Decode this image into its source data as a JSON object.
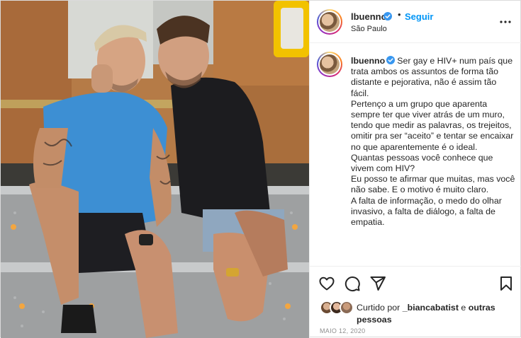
{
  "post": {
    "image_alt": "Two men sitting together on a metal step platform in front of an orange truck",
    "header": {
      "username": "lbuenno",
      "separator": "•",
      "follow_label": "Seguir",
      "location": "São Paulo"
    },
    "caption": {
      "username": "lbuenno",
      "lines": [
        "Ser gay e HIV+ num país que trata ambos os assuntos de forma tão distante e pejorativa, não é assim tão fácil.",
        "Pertenço a um grupo que aparenta sempre ter que viver atrás de um muro, tendo que medir as palavras, os trejeitos, omitir pra ser “aceito” e tentar se encaixar no que aparentemente é o ideal.",
        "Quantas pessoas você conhece que vivem com HIV?",
        "Eu posso te afirmar que muitas, mas você não sabe. E o motivo é muito claro.",
        "A falta de informação, o medo do olhar invasivo, a falta de diálogo, a falta de empatia."
      ]
    },
    "likes": {
      "prefix": "Curtido por",
      "user": "_biancabatist",
      "connector": "e",
      "others": "outras pessoas"
    },
    "date": "MAIO 12, 2020",
    "icons": {
      "verified": "verified-badge-icon",
      "more": "more-horizontal-icon",
      "like": "heart-icon",
      "comment": "comment-icon",
      "share": "paper-plane-icon",
      "save": "bookmark-icon"
    },
    "colors": {
      "link_blue": "#0095f6",
      "verified_blue": "#3897f0",
      "text": "#262626",
      "muted": "#8e8e8e"
    }
  }
}
